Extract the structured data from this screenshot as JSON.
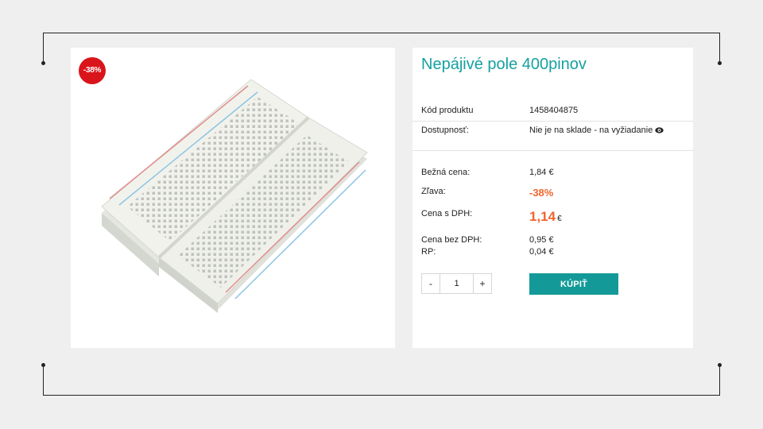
{
  "product": {
    "title": "Nepájivé pole 400pinov",
    "discount_badge": "-38%"
  },
  "details": {
    "code_label": "Kód produktu",
    "code_value": "1458404875",
    "availability_label": "Dostupnosť:",
    "availability_value": "Nie je na sklade - na vyžiadanie",
    "availability_icon": "eye-icon"
  },
  "pricing": {
    "regular_label": "Bežná cena:",
    "regular_value": "1,84 €",
    "discount_label": "Zľava:",
    "discount_value": "-38%",
    "price_vat_label": "Cena s DPH:",
    "price_vat_value": "1,14",
    "price_vat_currency": "€",
    "price_novat_label": "Cena bez DPH:",
    "price_novat_value": "0,95 €",
    "rp_label": "RP:",
    "rp_value": "0,04 €"
  },
  "cart": {
    "minus_label": "-",
    "quantity": "1",
    "plus_label": "+",
    "buy_label": "KÚPIŤ"
  },
  "colors": {
    "accent": "#17a0a0",
    "buy_button": "#139a98",
    "price": "#f0652d",
    "badge": "#d9151b"
  }
}
